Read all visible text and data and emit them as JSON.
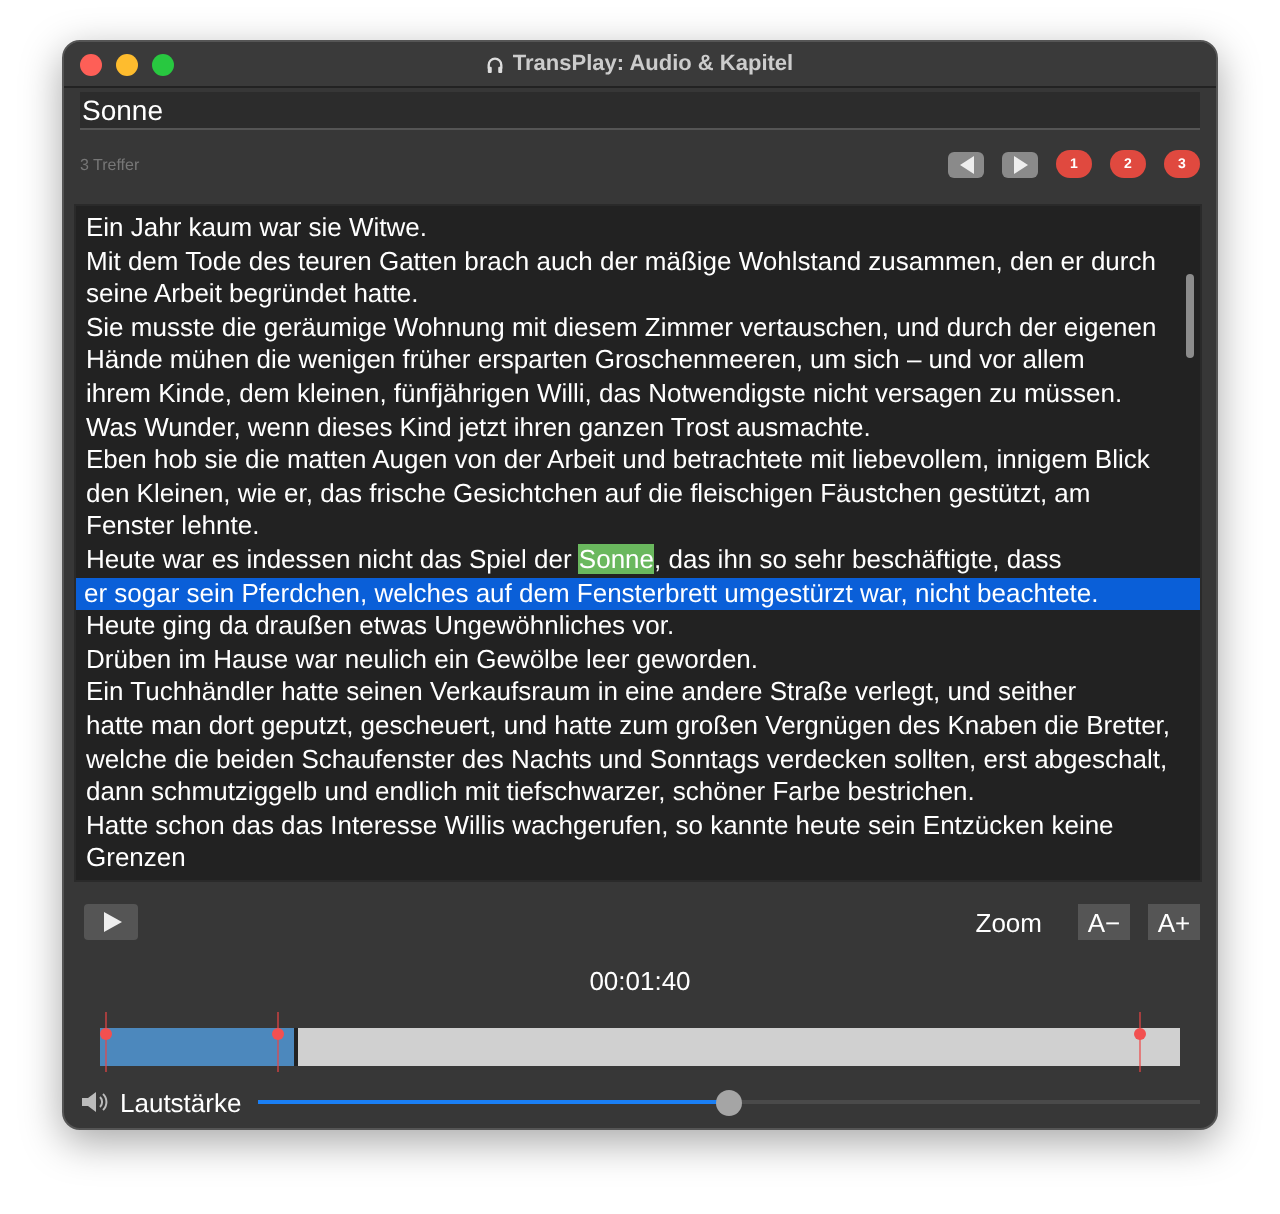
{
  "window": {
    "title": "TransPlay: Audio & Kapitel"
  },
  "search": {
    "value": "Sonne"
  },
  "hits": {
    "count": "3 Treffer",
    "chapters": [
      {
        "label": "1"
      },
      {
        "label": "2"
      },
      {
        "label": "3"
      }
    ]
  },
  "text_lines": [
    {
      "text": "Ein Jahr kaum war sie Witwe.",
      "selected": false
    },
    {
      "text": "Mit dem Tode des teuren Gatten brach auch der mäßige Wohlstand zusammen, den er durch",
      "selected": false
    },
    {
      "text": "seine Arbeit begründet hatte.",
      "selected": false
    },
    {
      "text": "Sie musste die geräumige Wohnung mit diesem Zimmer vertauschen, und durch der eigenen",
      "selected": false
    },
    {
      "text": "Hände mühen die wenigen früher ersparten Groschenmeeren, um sich – und vor allem",
      "selected": false
    },
    {
      "text": "ihrem Kinde, dem kleinen, fünfjährigen Willi, das Notwendigste nicht versagen zu müssen.",
      "selected": false
    },
    {
      "text": "Was Wunder, wenn dieses Kind jetzt ihren ganzen Trost ausmachte.",
      "selected": false
    },
    {
      "text": "Eben hob sie die matten Augen von der Arbeit und betrachtete mit liebevollem, innigem Blick",
      "selected": false
    },
    {
      "text": "den Kleinen, wie er, das frische Gesichtchen auf die fleischigen Fäustchen gestützt, am",
      "selected": false
    },
    {
      "text": "Fenster lehnte.",
      "selected": false
    },
    {
      "text": "Heute war es indessen nicht das Spiel der ",
      "match": "Sonne",
      "after": ", das ihn so sehr beschäftigte, dass",
      "selected": false
    },
    {
      "text": "er sogar sein Pferdchen, welches auf dem Fensterbrett umgestürzt war, nicht beachtete.",
      "selected": true
    },
    {
      "text": "Heute ging da draußen etwas Ungewöhnliches vor.",
      "selected": false
    },
    {
      "text": "Drüben im Hause war neulich ein Gewölbe leer geworden.",
      "selected": false
    },
    {
      "text": "Ein Tuchhändler hatte seinen Verkaufsraum in eine andere Straße verlegt, und seither",
      "selected": false
    },
    {
      "text": "hatte man dort geputzt, gescheuert, und hatte zum großen Vergnügen des Knaben die Bretter,",
      "selected": false
    },
    {
      "text": "welche die beiden Schaufenster des Nachts und Sonntags verdecken sollten, erst abgeschalt,",
      "selected": false
    },
    {
      "text": "dann schmutziggelb und endlich mit tiefschwarzer, schöner Farbe bestrichen.",
      "selected": false
    },
    {
      "text": "Hatte schon das das Interesse Willis wachgerufen, so kannte heute sein Entzücken keine",
      "selected": false
    },
    {
      "text": "Grenzen",
      "selected": false
    }
  ],
  "zoom": {
    "label": "Zoom",
    "buttons": [
      "A−",
      "A+"
    ]
  },
  "time": "00:01:40",
  "timeline": {
    "level": 0.18,
    "chapter_markers": [
      {
        "level": 0.006
      },
      {
        "level": 0.165
      },
      {
        "level": 0.963
      }
    ]
  },
  "volume": {
    "label": "Lautstärke",
    "level": 0.5
  }
}
